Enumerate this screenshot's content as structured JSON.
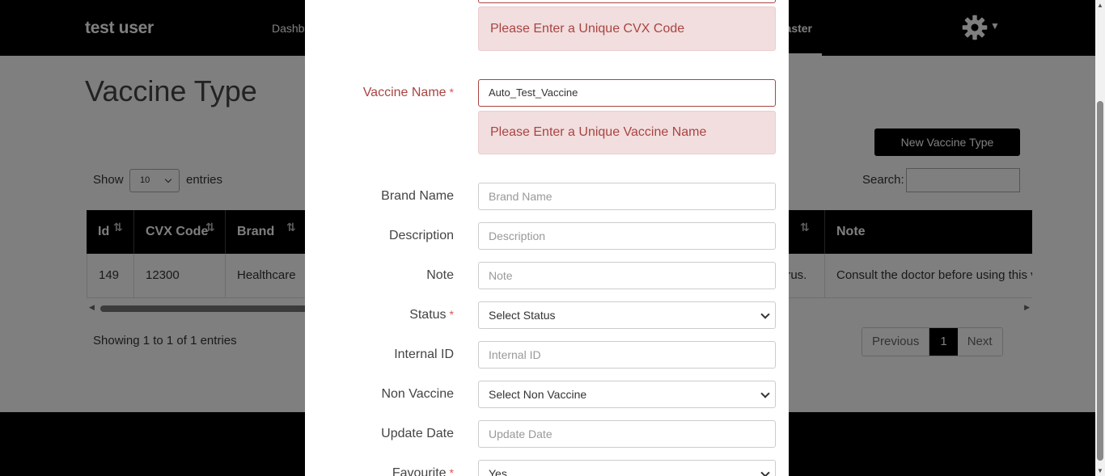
{
  "navbar": {
    "brand": "test user",
    "dashboard_fragment": "Dashb",
    "master_fragment": "aster",
    "icons": [
      "gear-icon",
      "caret-down-icon"
    ]
  },
  "page": {
    "title": "Vaccine Type",
    "new_button": "New Vaccine Type",
    "show_label": "Show",
    "entries_value": "10",
    "entries_label": "entries",
    "search_label": "Search:",
    "columns": [
      "Id",
      "CVX Code",
      "Brand",
      "Note"
    ],
    "row": {
      "id": "149",
      "cvx": "12300",
      "brand": "Healthcare",
      "desc_fragment": "irus.",
      "note": "Consult the doctor before using this v"
    },
    "showing": "Showing 1 to 1 of 1 entries",
    "pager": {
      "prev": "Previous",
      "current": "1",
      "next": "Next"
    }
  },
  "modal": {
    "cvx_error": "Please Enter a Unique CVX Code",
    "vaccine_name": {
      "label": "Vaccine Name",
      "value": "Auto_Test_Vaccine",
      "error": "Please Enter a Unique Vaccine Name"
    },
    "brand_name": {
      "label": "Brand Name",
      "placeholder": "Brand Name"
    },
    "description": {
      "label": "Description",
      "placeholder": "Description"
    },
    "note": {
      "label": "Note",
      "placeholder": "Note"
    },
    "status": {
      "label": "Status",
      "value": "Select Status"
    },
    "internal_id": {
      "label": "Internal ID",
      "placeholder": "Internal ID"
    },
    "non_vaccine": {
      "label": "Non Vaccine",
      "value": "Select Non Vaccine"
    },
    "update_date": {
      "label": "Update Date",
      "placeholder": "Update Date"
    },
    "favourite": {
      "label": "Favourite",
      "value": "Yes"
    },
    "required_mark": "*"
  },
  "colors": {
    "error": "#a94442",
    "error_bg": "#f2dede",
    "required": "#d9534f",
    "nav_bg": "#000000"
  }
}
